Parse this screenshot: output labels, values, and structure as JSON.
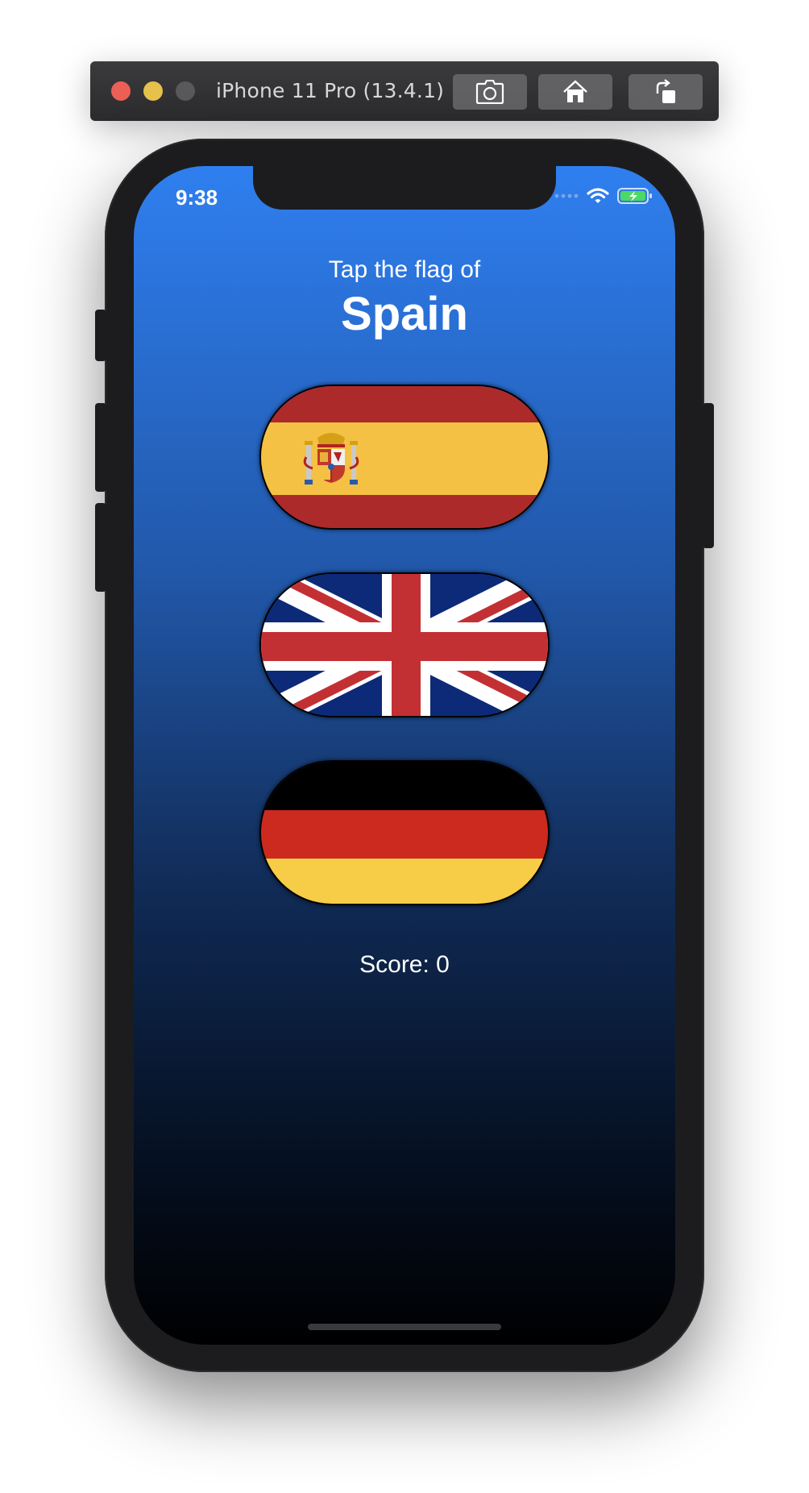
{
  "simulator": {
    "title": "iPhone 11 Pro (13.4.1)",
    "buttons": [
      "screenshot-icon",
      "home-icon",
      "rotate-icon"
    ]
  },
  "status_bar": {
    "time": "9:38",
    "icons": [
      "signal-dots-icon",
      "wifi-icon",
      "battery-charging-icon"
    ],
    "battery_color": "#4cd964"
  },
  "game": {
    "prompt": "Tap the flag of",
    "country": "Spain",
    "flags": [
      {
        "country": "Spain",
        "icon": "spain-flag-icon"
      },
      {
        "country": "UK",
        "icon": "uk-flag-icon"
      },
      {
        "country": "Germany",
        "icon": "germany-flag-icon"
      }
    ],
    "score_text": "Score: 0"
  },
  "colors": {
    "background_top": "#2f7ff0",
    "background_bottom": "#000000",
    "spain_red": "#ad2a2a",
    "spain_yellow": "#f4c144",
    "uk_blue": "#0d2a78",
    "uk_red": "#c33034",
    "germany_red": "#cc2a1f",
    "germany_gold": "#f7cd47"
  }
}
